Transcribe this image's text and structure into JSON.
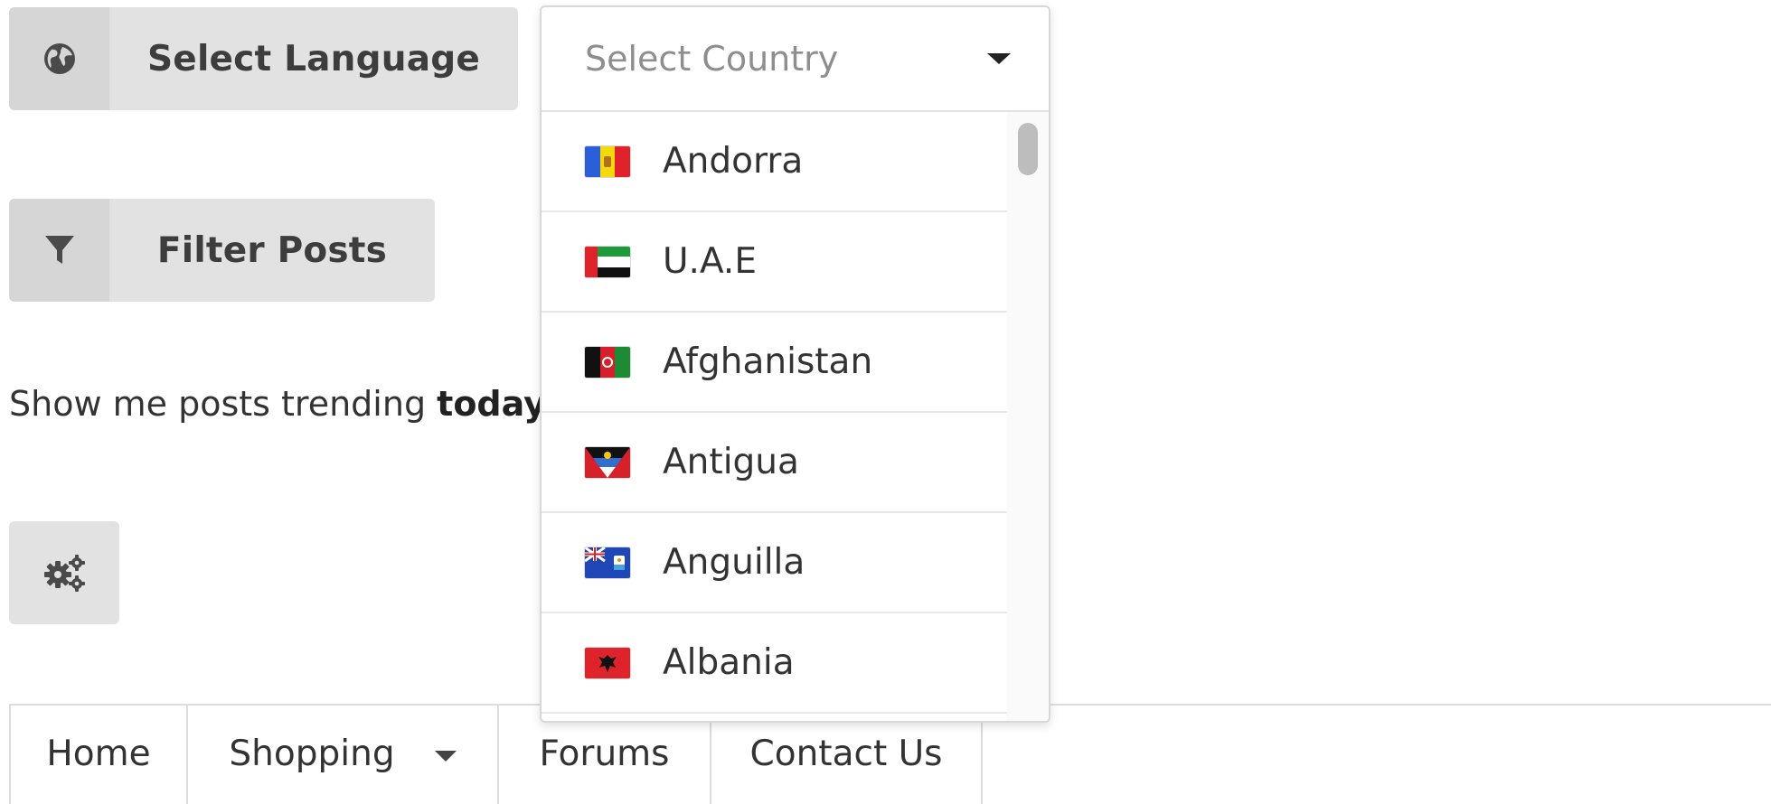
{
  "language_button": {
    "label": "Select Language",
    "icon": "globe-icon"
  },
  "filter_button": {
    "label": "Filter Posts",
    "icon": "filter-icon"
  },
  "settings_button": {
    "icon": "gears-icon"
  },
  "trending": {
    "prefix": "Show me posts trending ",
    "period": "today"
  },
  "country_select": {
    "placeholder": "Select Country",
    "options": [
      {
        "name": "Andorra",
        "flag_icon": "andorra-flag-icon"
      },
      {
        "name": "U.A.E",
        "flag_icon": "uae-flag-icon"
      },
      {
        "name": "Afghanistan",
        "flag_icon": "afghanistan-flag-icon"
      },
      {
        "name": "Antigua",
        "flag_icon": "antigua-flag-icon"
      },
      {
        "name": "Anguilla",
        "flag_icon": "anguilla-flag-icon"
      },
      {
        "name": "Albania",
        "flag_icon": "albania-flag-icon"
      }
    ]
  },
  "nav": {
    "items": [
      {
        "label": "Home"
      },
      {
        "label": "Shopping"
      },
      {
        "label": "Forums"
      },
      {
        "label": "Contact Us"
      }
    ]
  },
  "colors": {
    "button_bg": "#e2e2e2",
    "button_icon_bg": "#d6d6d6",
    "text": "#333333",
    "placeholder": "#8e8e8e",
    "border": "#dcdcdc"
  }
}
